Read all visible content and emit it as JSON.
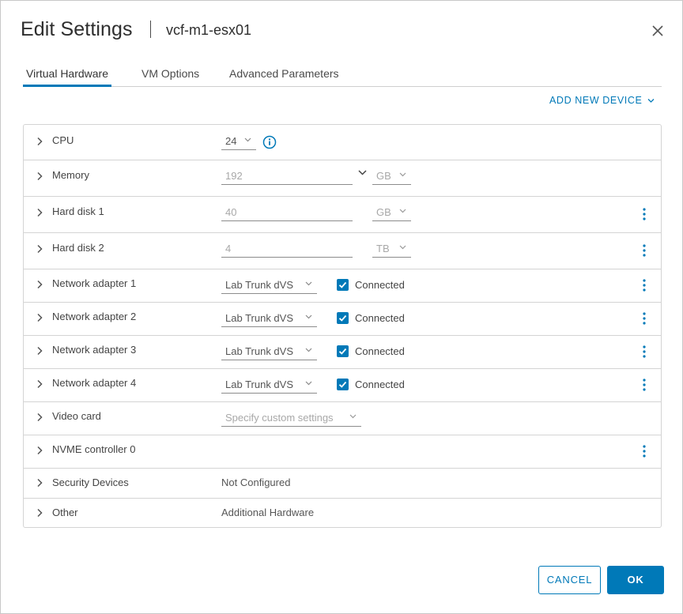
{
  "header": {
    "title": "Edit Settings",
    "vm_name": "vcf-m1-esx01"
  },
  "tabs": [
    {
      "label": "Virtual Hardware",
      "active": true
    },
    {
      "label": "VM Options",
      "active": false
    },
    {
      "label": "Advanced Parameters",
      "active": false
    }
  ],
  "add_device": {
    "label": "ADD NEW DEVICE"
  },
  "hardware": {
    "cpu": {
      "label": "CPU",
      "value": "24"
    },
    "memory": {
      "label": "Memory",
      "value": "192",
      "unit": "GB"
    },
    "hard_disk_1": {
      "label": "Hard disk 1",
      "value": "40",
      "unit": "GB"
    },
    "hard_disk_2": {
      "label": "Hard disk 2",
      "value": "4",
      "unit": "TB"
    },
    "network_adapters": [
      {
        "label": "Network adapter 1",
        "network": "Lab Trunk dVS",
        "connected_label": "Connected",
        "connected": true
      },
      {
        "label": "Network adapter 2",
        "network": "Lab Trunk dVS",
        "connected_label": "Connected",
        "connected": true
      },
      {
        "label": "Network adapter 3",
        "network": "Lab Trunk dVS",
        "connected_label": "Connected",
        "connected": true
      },
      {
        "label": "Network adapter 4",
        "network": "Lab Trunk dVS",
        "connected_label": "Connected",
        "connected": true
      }
    ],
    "video_card": {
      "label": "Video card",
      "value": "Specify custom settings"
    },
    "nvme": {
      "label": "NVME controller 0"
    },
    "security": {
      "label": "Security Devices",
      "value": "Not Configured"
    },
    "other": {
      "label": "Other",
      "value": "Additional Hardware"
    }
  },
  "footer": {
    "cancel_label": "CANCEL",
    "ok_label": "OK"
  },
  "colors": {
    "accent": "#0079b8",
    "border": "#d4d4d4",
    "text": "#333333"
  },
  "icons": [
    "close-icon",
    "chevron-right-icon",
    "chevron-down-icon",
    "info-icon",
    "kebab-menu-icon",
    "checkbox-checked-icon"
  ]
}
